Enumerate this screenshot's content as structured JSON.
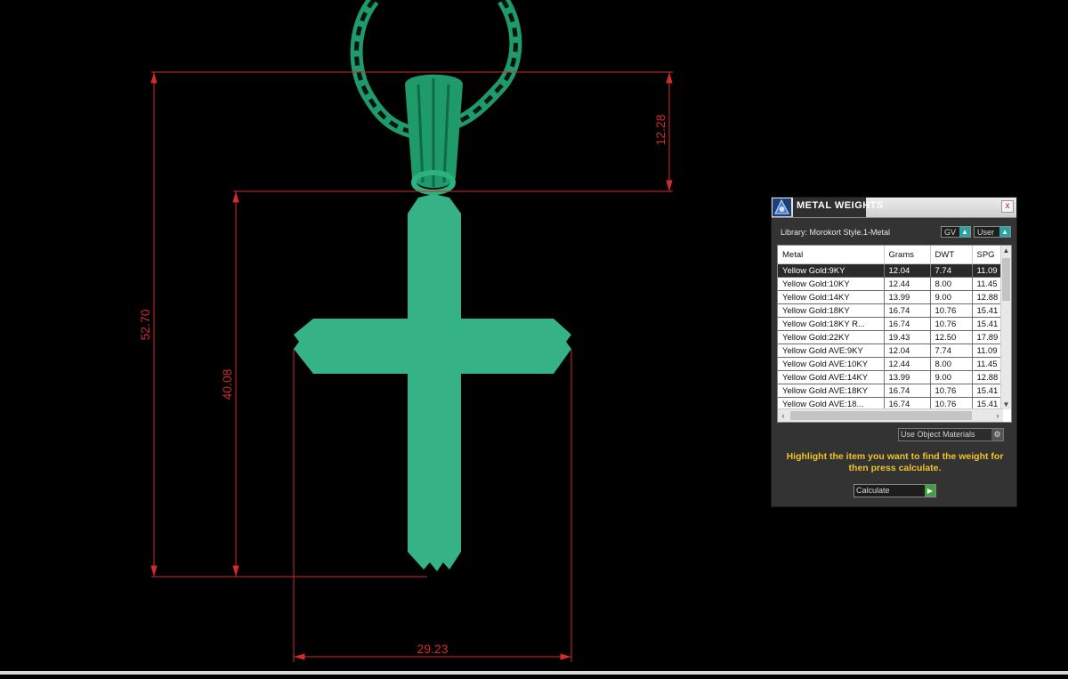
{
  "dimensions": {
    "height_total": "52.70",
    "height_cross": "40.08",
    "height_bail": "12.28",
    "width_cross": "29.23"
  },
  "colors": {
    "background": "#000000",
    "dimension_line": "#d42a2a",
    "cross_fill": "#36b287",
    "chain": "#1f9a6b",
    "instruction_text": "#f0c22a"
  },
  "panel": {
    "title": "METAL WEIGHTS",
    "close_label": "x",
    "library_label": "Library: Morokort Style.1-Metal",
    "gv_label": "GV",
    "user_label": "User",
    "table": {
      "columns": [
        "Metal",
        "Grams",
        "DWT",
        "SPG"
      ],
      "rows": [
        [
          "Yellow Gold:9KY",
          "12.04",
          "7.74",
          "11.09"
        ],
        [
          "Yellow Gold:10KY",
          "12.44",
          "8.00",
          "11.45"
        ],
        [
          "Yellow Gold:14KY",
          "13.99",
          "9.00",
          "12.88"
        ],
        [
          "Yellow Gold:18KY",
          "16.74",
          "10.76",
          "15.41"
        ],
        [
          "Yellow Gold:18KY R...",
          "16.74",
          "10.76",
          "15.41"
        ],
        [
          "Yellow Gold:22KY",
          "19.43",
          "12.50",
          "17.89"
        ],
        [
          "Yellow Gold AVE:9KY",
          "12.04",
          "7.74",
          "11.09"
        ],
        [
          "Yellow Gold AVE:10KY",
          "12.44",
          "8.00",
          "11.45"
        ],
        [
          "Yellow Gold AVE:14KY",
          "13.99",
          "9.00",
          "12.88"
        ],
        [
          "Yellow Gold AVE:18KY",
          "16.74",
          "10.76",
          "15.41"
        ],
        [
          "Yellow Gold AVE:18...",
          "16.74",
          "10.76",
          "15.41"
        ]
      ],
      "selected_row": 0
    },
    "use_object_materials": "Use Object Materials",
    "instructions": "Highlight the item you want to find the weight for then press calculate.",
    "calculate_label": "Calculate"
  }
}
